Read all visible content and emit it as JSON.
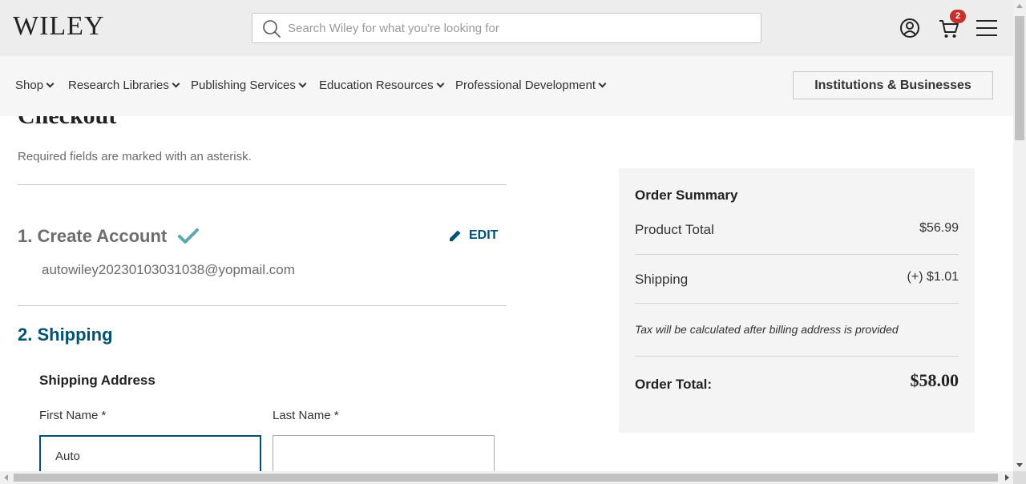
{
  "header": {
    "logo": "WILEY",
    "search_placeholder": "Search Wiley for what you're looking for",
    "cart_count": "2",
    "icons": [
      "search-icon",
      "account-icon",
      "cart-icon",
      "menu-icon"
    ]
  },
  "nav": {
    "items": [
      {
        "label": "Shop"
      },
      {
        "label": "Research Libraries"
      },
      {
        "label": "Publishing Services"
      },
      {
        "label": "Education Resources"
      },
      {
        "label": "Professional Development"
      }
    ],
    "institutions_button": "Institutions & Businesses"
  },
  "checkout": {
    "title": "Checkout",
    "required_note": "Required fields are marked with an asterisk.",
    "step1": {
      "title": "1. Create Account",
      "edit_label": "EDIT",
      "email": "autowiley20230103031038@yopmail.com"
    },
    "step2": {
      "title": "2. Shipping",
      "section_label": "Shipping Address",
      "first_name_label": "First Name *",
      "first_name_value": "Auto",
      "last_name_label": "Last Name *",
      "last_name_value": ""
    }
  },
  "summary": {
    "title": "Order Summary",
    "product_total_label": "Product Total",
    "product_total_value": "$56.99",
    "shipping_label": "Shipping",
    "shipping_value": "(+) $1.01",
    "tax_note": "Tax will be calculated after billing address is provided",
    "order_total_label": "Order Total:",
    "order_total_value": "$58.00"
  },
  "colors": {
    "brand_blue": "#005274",
    "check_teal": "#5ba8ae",
    "badge_red": "#c9302c"
  }
}
